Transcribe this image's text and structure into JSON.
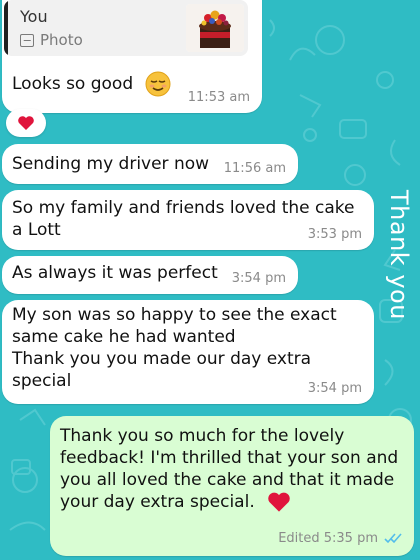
{
  "reply": {
    "author": "You",
    "attachment_label": "Photo",
    "thumbnail": "cake-photo-thumbnail"
  },
  "messages": [
    {
      "text": "Looks so good",
      "emoji": "relieved-face-emoji",
      "time": "11:53 am"
    },
    {
      "text": "Sending my driver now",
      "time": "11:56 am"
    },
    {
      "lines": [
        "So my family and friends loved the cake",
        "a Lott"
      ],
      "time": "3:53 pm"
    },
    {
      "text": "As always it was perfect",
      "time": "3:54 pm"
    },
    {
      "lines": [
        "My son was so happy to see the exact",
        "same cake he had wanted",
        "Thank you you made our day extra",
        "special"
      ],
      "time": "3:54 pm"
    }
  ],
  "reaction": {
    "emoji": "red-heart"
  },
  "outgoing": {
    "lines": [
      "Thank you so much for the lovely",
      "feedback! I'm thrilled that your son and",
      "you all loved the cake and that it made",
      "your day extra special."
    ],
    "emoji": "red-heart",
    "time": "Edited 5:35 pm",
    "status": "read-double-check"
  },
  "side_text": "Thank you",
  "colors": {
    "wallpaper": "#2fbcc4",
    "incoming_bubble": "#ffffff",
    "outgoing_bubble": "#d9fdd3",
    "read_ticks": "#53bdeb",
    "heart": "#e0143c"
  }
}
